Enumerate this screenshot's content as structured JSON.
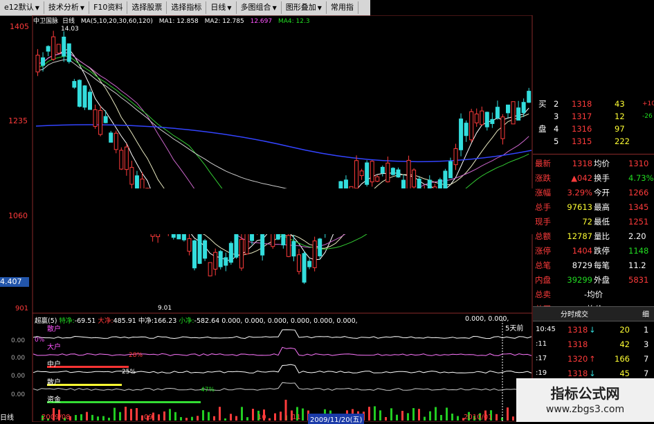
{
  "toolbar": {
    "items": [
      {
        "label": "e12默认",
        "dropdown": true
      },
      {
        "label": "技术分析",
        "dropdown": true
      },
      {
        "label": "F10资料",
        "dropdown": false
      },
      {
        "label": "选择股票",
        "dropdown": false
      },
      {
        "label": "选择指标",
        "dropdown": false
      },
      {
        "label": "日线",
        "dropdown": true
      },
      {
        "label": "多图组合",
        "dropdown": true
      },
      {
        "label": "图形叠加",
        "dropdown": true
      },
      {
        "label": "常用指",
        "dropdown": false
      }
    ]
  },
  "stock": {
    "name": "中卫国脉",
    "period": "日线",
    "ma_params": "MA(5,10,20,30,60,120)",
    "ma1": "MA1: 12.858",
    "ma2": "MA2: 12.785",
    "ma3": "12.697",
    "ma4": "MA4: 12.3"
  },
  "price_axis": {
    "labels": [
      "1405",
      "1235",
      "1060",
      "901"
    ],
    "current": "4.407",
    "high_note": "14.03",
    "low_note": "9.01"
  },
  "indicator": {
    "title": "超赢(5)",
    "spec_label": "特净:",
    "spec_value": "-69.51",
    "big_label": "大净:",
    "big_value": "485.91",
    "mid_label": "中净:",
    "mid_value": "166.23",
    "small_label": "小净:",
    "small_value": "-582.64",
    "tail_values": "0.000, 0.000, 0.000, 0.000, 0.000, 0.000,",
    "tail_values_2": "0.000, 0.000,",
    "days_label": "5天前",
    "sublabels": [
      {
        "name": "散户",
        "pct": "0%"
      },
      {
        "name": "大户",
        "pct": "28%"
      },
      {
        "name": "中户",
        "pct": "25%"
      },
      {
        "name": "散户",
        "pct": "47%"
      },
      {
        "name": "资金",
        "pct": ""
      }
    ],
    "left_value": "0.00",
    "left_value_2": "0.00",
    "left_value_3": "0.00",
    "left_value_4": "0.00"
  },
  "bottom_dates": [
    "2009/08",
    "09",
    "10",
    "11",
    "2009/11/20(五)",
    "2010/01"
  ],
  "bottom_left_label": "日线",
  "order_book": [
    {
      "side": "买",
      "level": "2",
      "price": "1318",
      "vol": "43",
      "chg": "+10"
    },
    {
      "side": "",
      "level": "3",
      "price": "1317",
      "vol": "12",
      "chg": "-26"
    },
    {
      "side": "盘",
      "level": "4",
      "price": "1316",
      "vol": "97",
      "chg": ""
    },
    {
      "side": "",
      "level": "5",
      "price": "1315",
      "vol": "222",
      "chg": ""
    }
  ],
  "quote": [
    {
      "k1": "最新",
      "v1": "1318",
      "k2": "均价",
      "v2": "1310"
    },
    {
      "k1": "涨跌",
      "v1": "▲042",
      "k2": "换手",
      "v2": "4.73%"
    },
    {
      "k1": "涨幅",
      "v1": "3.29%",
      "k2": "今开",
      "v2": "1266"
    },
    {
      "k1": "总手",
      "v1": "97613",
      "k2": "最高",
      "v2": "1345"
    },
    {
      "k1": "现手",
      "v1": "72",
      "k2": "最低",
      "v2": "1251"
    },
    {
      "k1": "总额",
      "v1": "12787",
      "k2": "量比",
      "v2": "2.20"
    },
    {
      "k1": "涨停",
      "v1": "1404",
      "k2": "跌停",
      "v2": "1148"
    },
    {
      "k1": "总笔",
      "v1": "8729",
      "k2": "每笔",
      "v2": "11.2"
    },
    {
      "k1": "内盘",
      "v1": "39299",
      "k2": "外盘",
      "v2": "5831"
    },
    {
      "k1": "总卖",
      "v1": "",
      "k2": "-均价",
      "v2": ""
    },
    {
      "k1": "总买",
      "v1": "",
      "k2": "-均价",
      "v2": ""
    }
  ],
  "tabs": {
    "active": "分时成交",
    "other": "细"
  },
  "trades": [
    {
      "time": "10:45",
      "price": "1318",
      "dir": "down",
      "vol": "20",
      "flag": "1"
    },
    {
      "time": ":11",
      "price": "1318",
      "dir": "",
      "vol": "42",
      "flag": "3"
    },
    {
      "time": ":17",
      "price": "1320",
      "dir": "up",
      "vol": "166",
      "flag": "7"
    },
    {
      "time": ":19",
      "price": "1318",
      "dir": "down",
      "vol": "45",
      "flag": "7"
    }
  ],
  "watermark": {
    "title": "指标公式网",
    "url": "www.zbgs3.com"
  },
  "colors": {
    "up": "#ff3b3b",
    "down": "#22dddd",
    "bg": "#000000",
    "toolbar": "#d6d6d6"
  }
}
